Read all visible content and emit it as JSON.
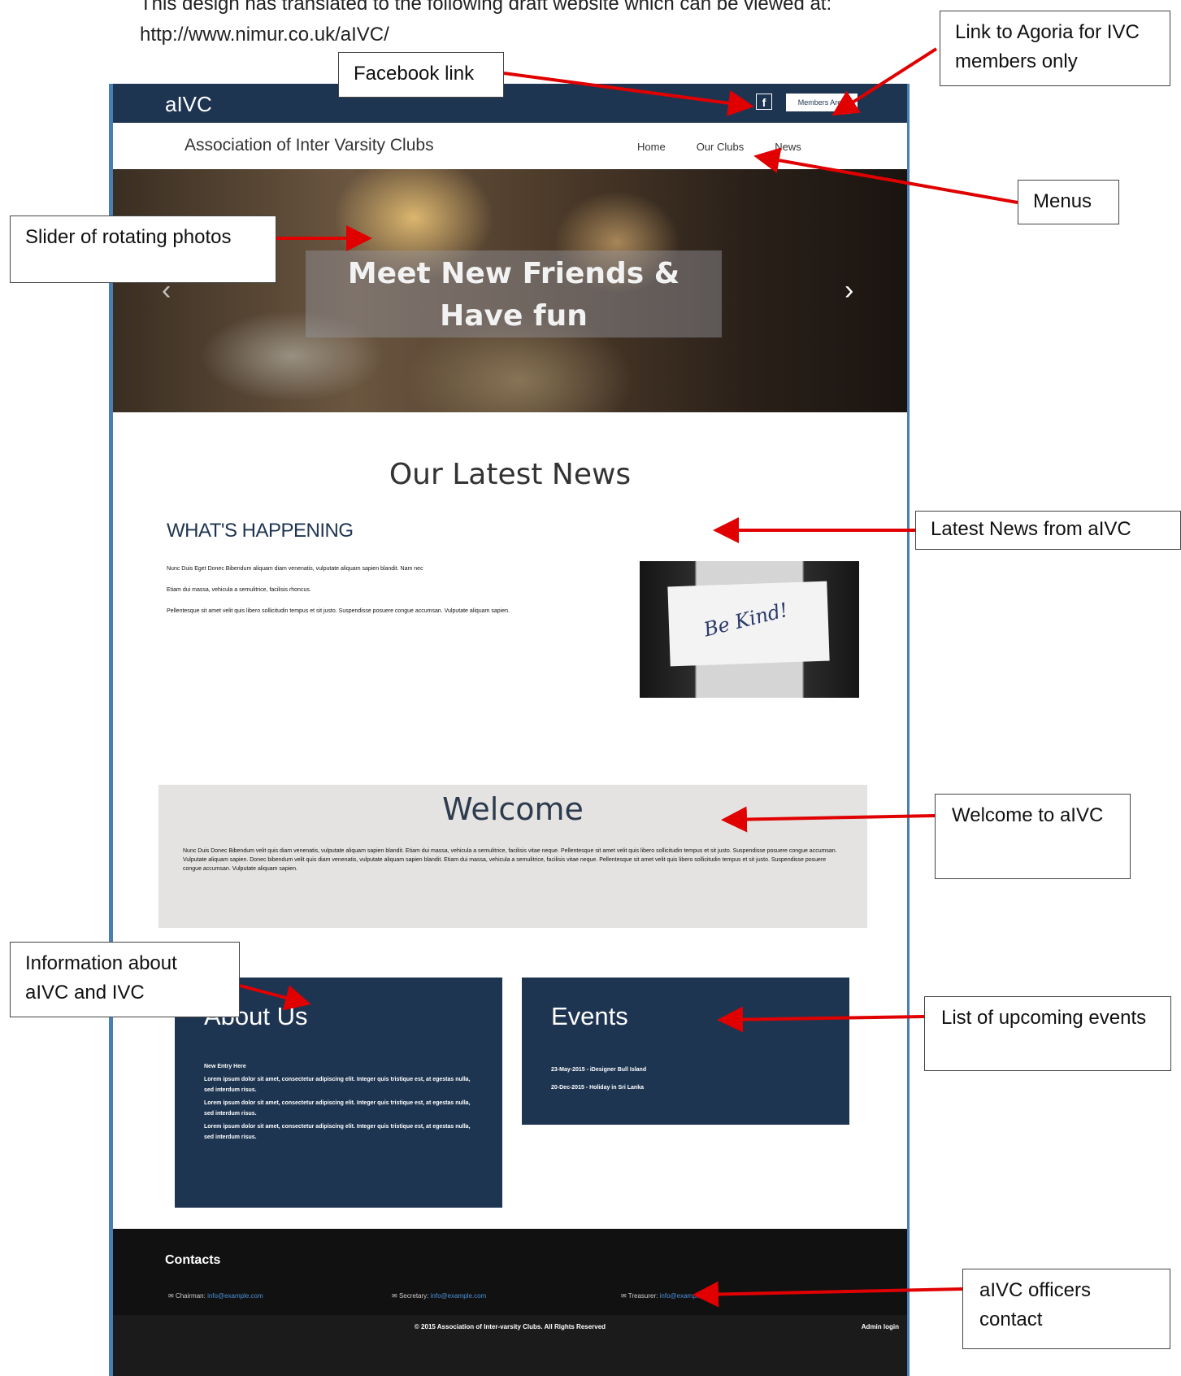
{
  "intro_text": "This design has translated to the following draft website which can be viewed at:",
  "intro_url": "http://www.nimur.co.uk/aIVC/",
  "site": {
    "brand": "aIVC",
    "facebook_icon": "f",
    "member_button": "Members Area",
    "title": "Association of Inter Varsity Clubs",
    "menu": [
      "Home",
      "Our Clubs",
      "News"
    ],
    "hero": {
      "line1": "Meet New Friends &",
      "line2": "Have fun"
    },
    "news": {
      "heading": "Our Latest News",
      "subheading": "WHAT'S HAPPENING",
      "paragraphs": [
        "Nunc Duis Eget Donec Bibendum aliquam diam venenatis, vulputate aliquam sapien blandit. Nam nec",
        "Etiam dui massa, vehicula a semulitrice, facilisis rhoncus.",
        "Pellentesque sit amet velit quis libero sollicitudin tempus et sit justo. Suspendisse posuere congue accumsan. Vulputate aliquam sapien."
      ],
      "image_caption": "Be Kind!"
    },
    "welcome": {
      "title": "Welcome",
      "text": "Nunc Duis Donec Bibendum velit quis diam venenatis, vulputate aliquam sapien blandit. Etiam dui massa, vehicula a semulitrice, facilisis vitae neque. Pellentesque sit amet velit quis libero sollicitudin tempus et sit justo. Suspendisse posuere congue accumsan. Vulputate aliquam sapien. Donec bibendum velit quis diam venenatis, vulputate aliquam sapien blandit. Etiam dui massa, vehicula a semulitrice, facilisis vitae neque. Pellentesque sit amet velit quis libero sollicitudin tempus et sit justo. Suspendisse posuere congue accumsan. Vulputate aliquam sapien."
    },
    "about": {
      "title": "About Us",
      "entries": [
        "New Entry Here",
        "Lorem ipsum dolor sit amet, consectetur adipiscing elit. Integer quis tristique est, at egestas nulla, sed interdum risus.",
        "Lorem ipsum dolor sit amet, consectetur adipiscing elit. Integer quis tristique est, at egestas nulla, sed interdum risus.",
        "Lorem ipsum dolor sit amet, consectetur adipiscing elit. Integer quis tristique est, at egestas nulla, sed interdum risus."
      ]
    },
    "events": {
      "title": "Events",
      "items": [
        "23-May-2015 - iDesigner Bull Island",
        "20-Dec-2015 - Holiday in Sri Lanka"
      ]
    },
    "contacts": {
      "title": "Contacts",
      "items": [
        {
          "role": "Chairman:",
          "email": "info@example.com"
        },
        {
          "role": "Secretary:",
          "email": "info@example.com"
        },
        {
          "role": "Treasurer:",
          "email": "info@example.com"
        }
      ]
    },
    "footer": {
      "copyright": "© 2015 Association of Inter-varsity Clubs. All Rights Reserved",
      "admin": "Admin login"
    }
  },
  "callouts": {
    "facebook": "Facebook link",
    "agoria": "Link to Agoria for IVC members only",
    "menus": "Menus",
    "slider": "Slider of rotating photos",
    "news": "Latest News from aIVC",
    "welcome": "Welcome to aIVC",
    "info": "Information about aIVC and IVC",
    "events": "List of upcoming events",
    "officers": "aIVC officers contact"
  },
  "colors": {
    "navy": "#1e3552",
    "annotation_arrow": "#e00000"
  }
}
